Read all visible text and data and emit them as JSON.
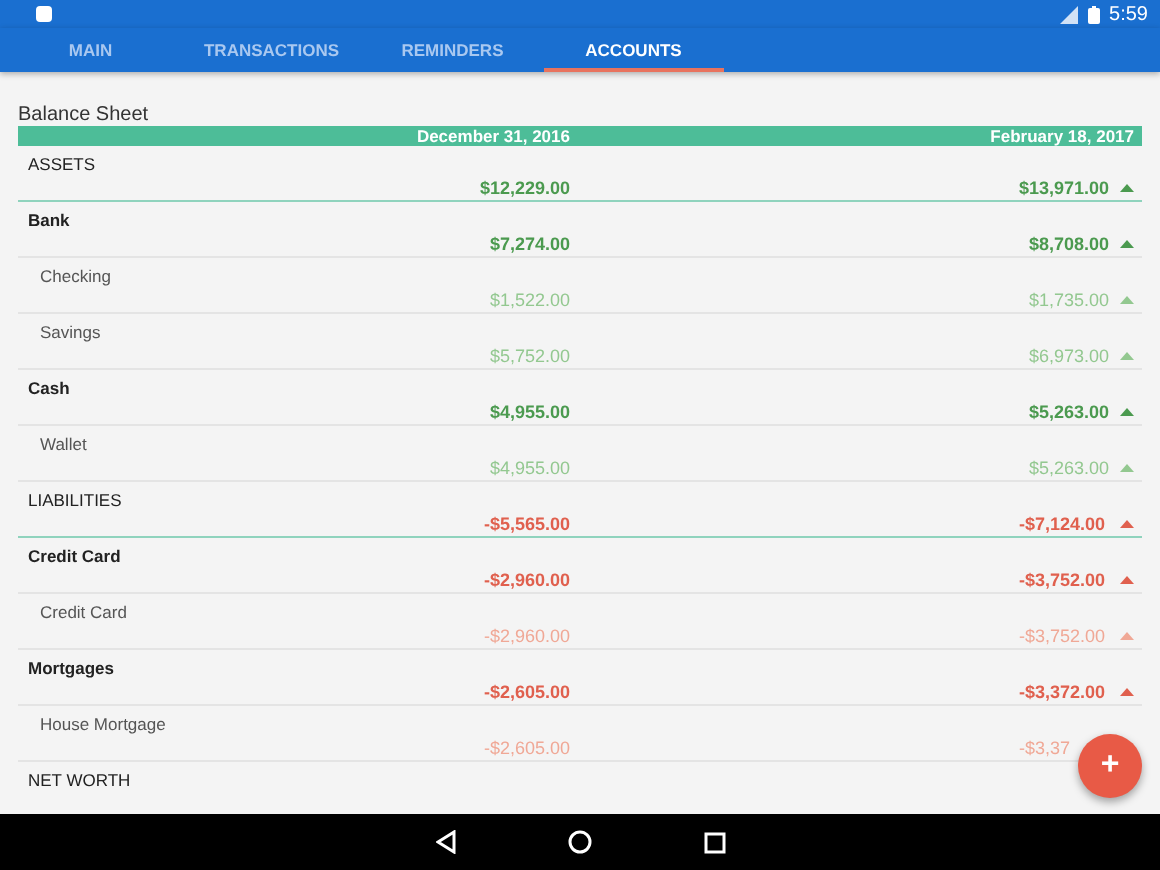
{
  "status_bar": {
    "time": "5:59"
  },
  "tabs": [
    {
      "label": "MAIN",
      "selected": false
    },
    {
      "label": "TRANSACTIONS",
      "selected": false
    },
    {
      "label": "REMINDERS",
      "selected": false
    },
    {
      "label": "ACCOUNTS",
      "selected": true
    }
  ],
  "title": "Balance Sheet",
  "columns": [
    "December 31, 2016",
    "February 18, 2017"
  ],
  "rows": [
    {
      "kind": "section",
      "name": "ASSETS",
      "negative": false,
      "amounts": [
        "$12,229.00",
        "$13,971.00"
      ],
      "rising": true
    },
    {
      "kind": "group",
      "name": "Bank",
      "negative": false,
      "amounts": [
        "$7,274.00",
        "$8,708.00"
      ],
      "rising": true
    },
    {
      "kind": "account",
      "name": "Checking",
      "negative": false,
      "amounts": [
        "$1,522.00",
        "$1,735.00"
      ],
      "rising": true
    },
    {
      "kind": "account",
      "name": "Savings",
      "negative": false,
      "amounts": [
        "$5,752.00",
        "$6,973.00"
      ],
      "rising": true
    },
    {
      "kind": "group",
      "name": "Cash",
      "negative": false,
      "amounts": [
        "$4,955.00",
        "$5,263.00"
      ],
      "rising": true
    },
    {
      "kind": "account",
      "name": "Wallet",
      "negative": false,
      "amounts": [
        "$4,955.00",
        "$5,263.00"
      ],
      "rising": true
    },
    {
      "kind": "section",
      "name": "LIABILITIES",
      "negative": true,
      "amounts": [
        "-$5,565.00",
        "-$7,124.00"
      ],
      "rising": true
    },
    {
      "kind": "group",
      "name": "Credit Card",
      "negative": true,
      "amounts": [
        "-$2,960.00",
        "-$3,752.00"
      ],
      "rising": true
    },
    {
      "kind": "account",
      "name": "Credit Card",
      "negative": true,
      "amounts": [
        "-$2,960.00",
        "-$3,752.00"
      ],
      "rising": true
    },
    {
      "kind": "group",
      "name": "Mortgages",
      "negative": true,
      "amounts": [
        "-$2,605.00",
        "-$3,372.00"
      ],
      "rising": true
    },
    {
      "kind": "account",
      "name": "House Mortgage",
      "negative": true,
      "amounts": [
        "-$2,605.00",
        "-$3,37"
      ]
    },
    {
      "kind": "section",
      "name": "NET WORTH"
    }
  ],
  "fab": {
    "label": "+"
  }
}
